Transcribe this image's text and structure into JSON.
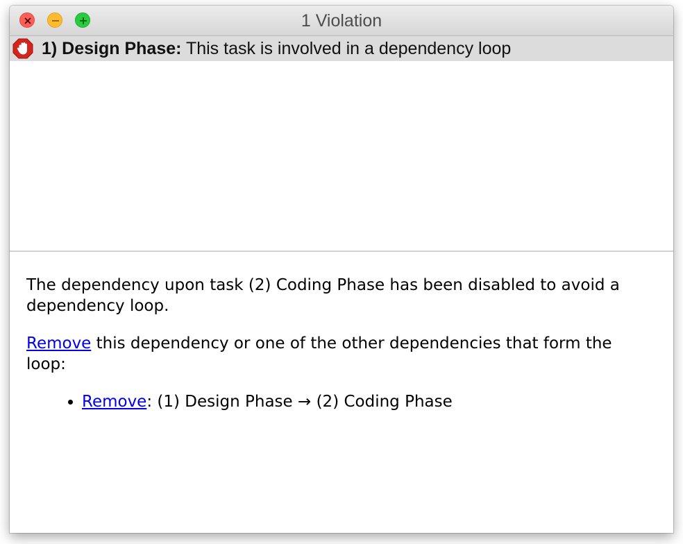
{
  "window": {
    "title": "1 Violation"
  },
  "violations": [
    {
      "name": "1) Design Phase:",
      "message": "This task is involved in a dependency loop",
      "icon": "stop-hand-icon",
      "icon_color": "#d0261e"
    }
  ],
  "details": {
    "paragraph1": "The dependency upon task (2) Coding Phase has been disabled to avoid a dependency loop.",
    "remove_link": "Remove",
    "paragraph2_rest": " this dependency or one of the other dependencies that form the loop:",
    "loop_items": [
      {
        "link": "Remove",
        "text": ": (1) Design Phase → (2) Coding Phase"
      }
    ]
  },
  "colors": {
    "link": "#0000ee",
    "selected_row": "#dcdcdc",
    "close": "#fc5f57",
    "minimize": "#fdbc2e",
    "zoom": "#2acb41"
  }
}
